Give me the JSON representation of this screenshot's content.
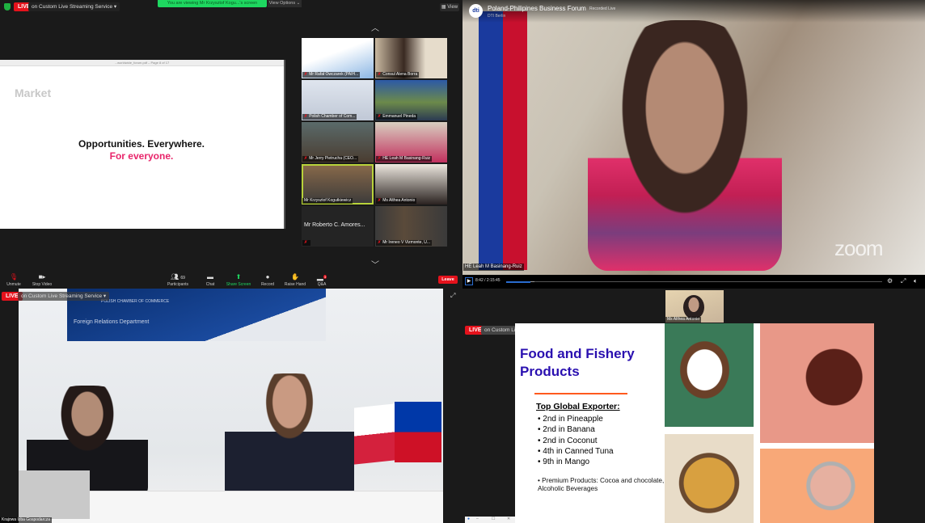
{
  "zoom_client": {
    "top_bar": {
      "live_badge": "LIVE",
      "stream_label": "on Custom Live Streaming Service",
      "stream_caret": "▾",
      "viewing_banner": "You are viewing Mr Krzysztof Kogu...'s screen",
      "view_options": "View Options ⌄",
      "view_button": "View"
    },
    "shared_screen": {
      "window_title": "...worldwide_forum.pdf – Page 8 of 17",
      "heading": "Market",
      "line1": "Opportunities. Everywhere.",
      "line2": "For everyone."
    },
    "gallery": {
      "scroll_up": "︿",
      "scroll_down": "﹀",
      "tiles": [
        {
          "name": "Mr Rafał Owczarek (PAIH..."
        },
        {
          "name": "Consul Alena Borra"
        },
        {
          "name": "Polish Chamber of Com..."
        },
        {
          "name": "Emmanuel Pineda"
        },
        {
          "name": "Mr Jerry Pietrucha (CEO..."
        },
        {
          "name": "HE Leah M Basinang-Ruiz"
        },
        {
          "name": "Mr Krzysztof Kogutkiewicz"
        },
        {
          "name": "Ms Althea Antonio"
        },
        {
          "name": "Mr Roberto C. Amores..."
        },
        {
          "name": "Mr Ireneo V Vizmonte, U..."
        }
      ]
    },
    "toolbar": {
      "unmute": "Unmute",
      "stop_video": "Stop Video",
      "participants": "Participants",
      "participants_count": "69",
      "chat": "Chat",
      "share_screen": "Share Screen",
      "record": "Record",
      "raise_hand": "Raise Hand",
      "qa": "Q&A",
      "qa_badge": "3",
      "leave": "Leave"
    },
    "colors": {
      "live_red": "#e5121c",
      "share_green": "#1ed760",
      "active_speaker": "#b8d23a"
    }
  },
  "recorded_stream": {
    "logo_text": "dti",
    "title": "Poland-Philipines Business Forum",
    "status": "Recorded Live",
    "channel": "DTI Berlin",
    "speaker_name": "HE Leah M Basinang-Ruiz",
    "watermark": "zoom",
    "player": {
      "time": "8:42 / 2:15:45",
      "progress_fraction": 0.064,
      "buffered_fraction": 0.075
    }
  },
  "room_stream": {
    "live_badge": "LIVE",
    "stream_label": "on Custom Live Streaming Service",
    "banner_org": "POLISH CHAMBER OF COMMERCE",
    "banner_dept": "Foreign Relations Department",
    "name_tag": "Krajowa Izba Gospodarcza"
  },
  "slide_stream": {
    "thumbnail_name": "Ms Althea Antonio",
    "live_badge": "LIVE",
    "stream_label": "on Custom Live Streaming Service",
    "slide": {
      "title": "Food and Fishery Products",
      "subheading": "Top Global Exporter:",
      "bullets": [
        "2nd in Pineapple",
        "2nd in Banana",
        "2nd in Coconut",
        "4th in Canned Tuna",
        "9th in Mango"
      ],
      "premium": "Premium Products: Cocoa and chocolate, Alcoholic Beverages"
    },
    "window_controls": {
      "minimize": "–",
      "maximize": "☐",
      "close": "✕"
    }
  }
}
